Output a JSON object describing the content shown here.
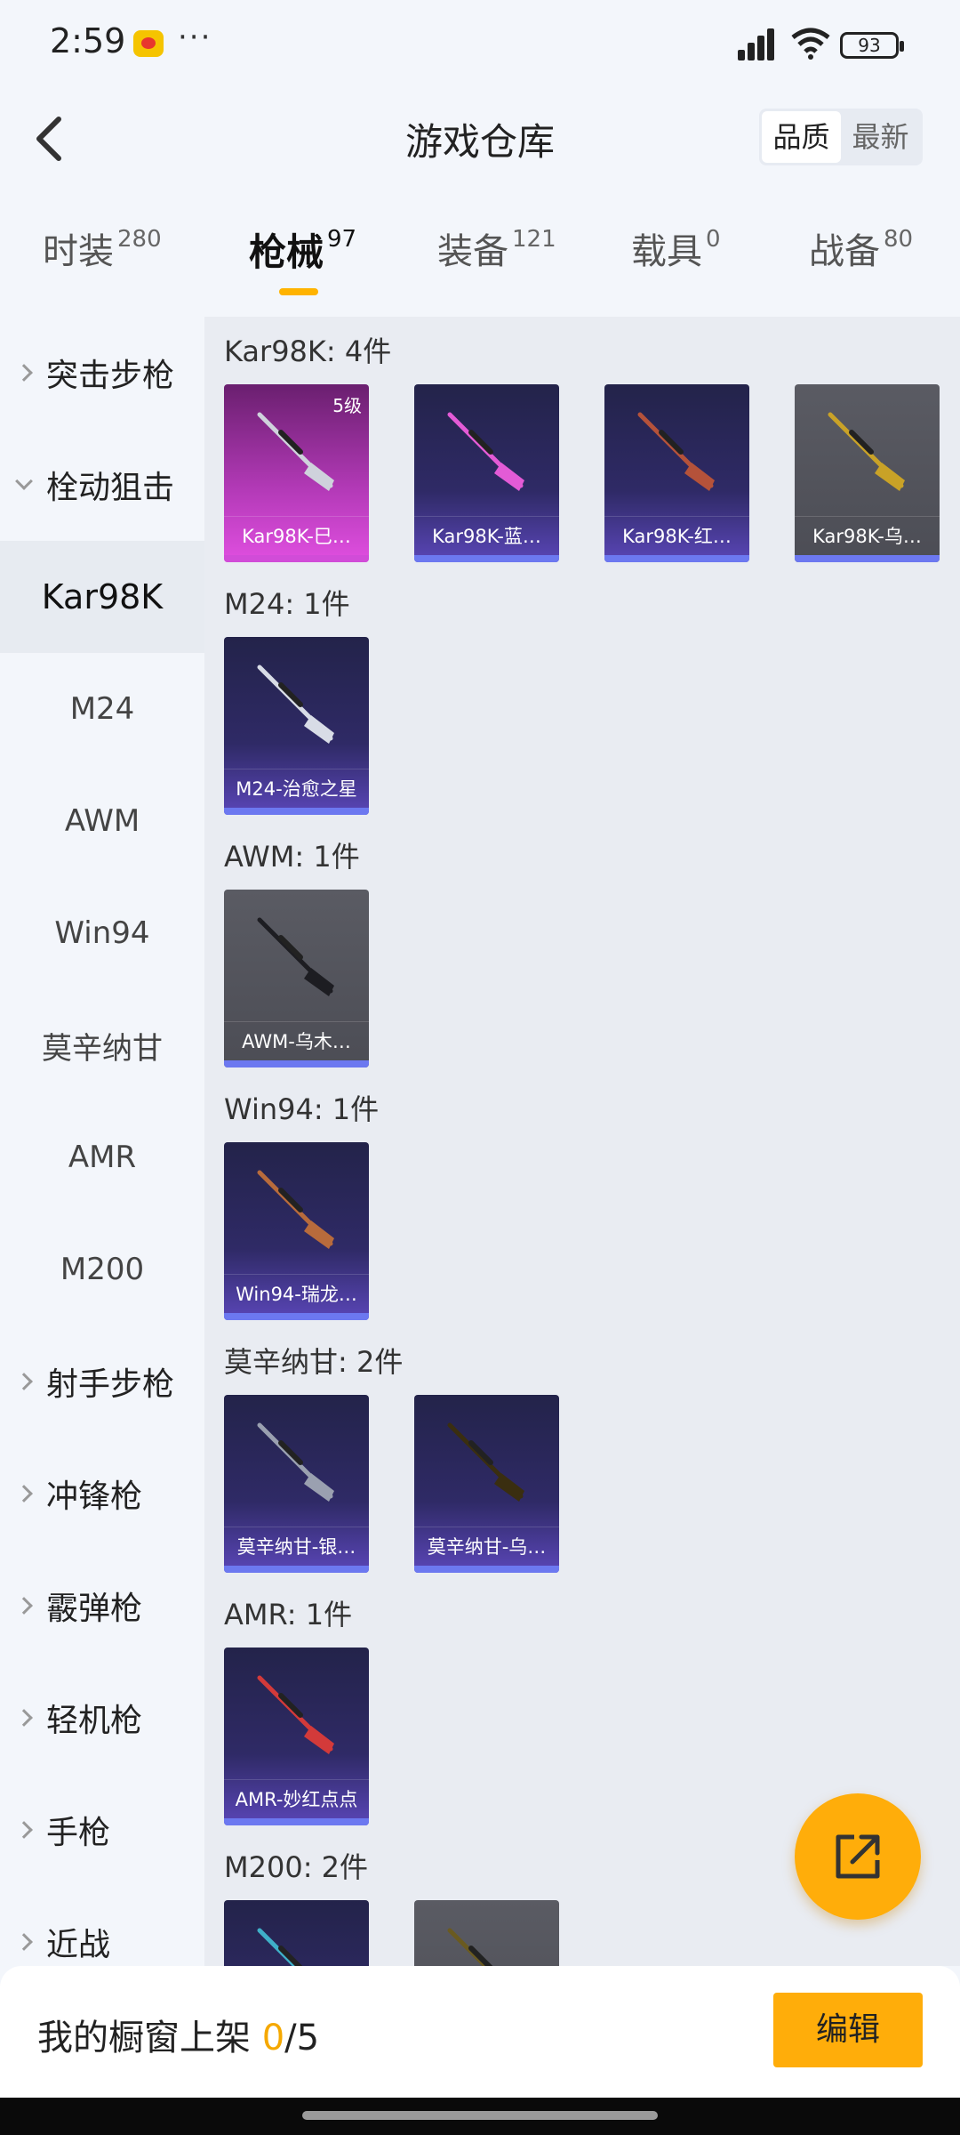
{
  "status_bar": {
    "time": "2:59",
    "more": "···",
    "battery": "93"
  },
  "header": {
    "title": "游戏仓库",
    "sort_options": [
      "品质",
      "最新"
    ]
  },
  "tabs": [
    {
      "label": "时装",
      "count": "280"
    },
    {
      "label": "枪械",
      "count": "97"
    },
    {
      "label": "装备",
      "count": "121"
    },
    {
      "label": "载具",
      "count": "0"
    },
    {
      "label": "战备",
      "count": "80"
    }
  ],
  "sidebar": {
    "items": [
      {
        "label": "突击步枪"
      },
      {
        "label": "栓动狙击"
      },
      {
        "label": "Kar98K"
      },
      {
        "label": "M24"
      },
      {
        "label": "AWM"
      },
      {
        "label": "Win94"
      },
      {
        "label": "莫辛纳甘"
      },
      {
        "label": "AMR"
      },
      {
        "label": "M200"
      },
      {
        "label": "射手步枪"
      },
      {
        "label": "冲锋枪"
      },
      {
        "label": "霰弹枪"
      },
      {
        "label": "轻机枪"
      },
      {
        "label": "手枪"
      },
      {
        "label": "近战"
      }
    ]
  },
  "groups": [
    {
      "title": "Kar98K: 4件",
      "items": [
        {
          "name": "Kar98K-巳…",
          "level": "5级",
          "tier": "pink"
        },
        {
          "name": "Kar98K-蓝…",
          "tier": "purple"
        },
        {
          "name": "Kar98K-红…",
          "tier": "purple"
        },
        {
          "name": "Kar98K-乌…",
          "tier": "gray"
        }
      ]
    },
    {
      "title": "M24: 1件",
      "items": [
        {
          "name": "M24-治愈之星",
          "tier": "purple"
        }
      ]
    },
    {
      "title": "AWM: 1件",
      "items": [
        {
          "name": "AWM-乌木…",
          "tier": "gray"
        }
      ]
    },
    {
      "title": "Win94: 1件",
      "items": [
        {
          "name": "Win94-瑞龙…",
          "tier": "purple"
        }
      ]
    },
    {
      "title": "莫辛纳甘: 2件",
      "items": [
        {
          "name": "莫辛纳甘-银…",
          "tier": "purple"
        },
        {
          "name": "莫辛纳甘-乌…",
          "tier": "purple"
        }
      ]
    },
    {
      "title": "AMR: 1件",
      "items": [
        {
          "name": "AMR-妙红点点",
          "tier": "purple"
        }
      ]
    },
    {
      "title": "M200: 2件",
      "items": [
        {
          "name": "",
          "tier": "purple"
        },
        {
          "name": "",
          "tier": "gray"
        }
      ]
    }
  ],
  "bottom_bar": {
    "label": "我的橱窗上架",
    "current": "0",
    "total": "/5",
    "edit_label": "编辑"
  },
  "colors": {
    "accent": "#ffad0a",
    "purple_tier": "#5a46b8",
    "pink_tier": "#d14cd8",
    "gray_tier": "#5a5b63"
  }
}
